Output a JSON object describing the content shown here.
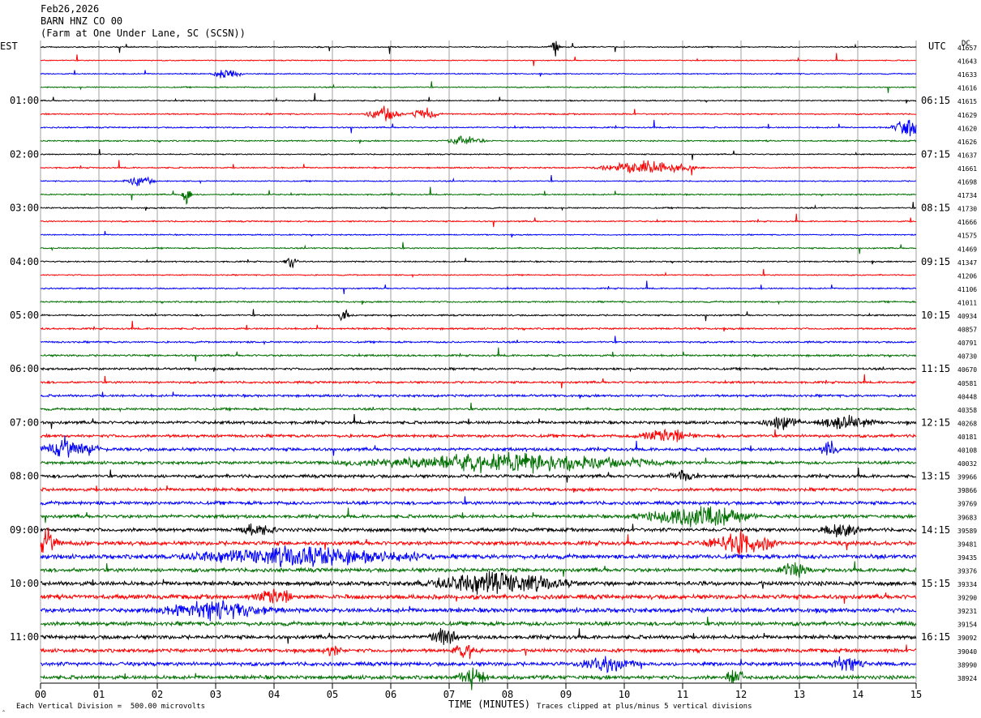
{
  "header": {
    "date": "Feb26,2026",
    "station": "BARN HNZ CO 00",
    "location": "(Farm at One Under Lane, SC (SCSN))"
  },
  "labels": {
    "left_tz": "EST",
    "right_tz": "UTC",
    "dc": "DC",
    "xlabel": "TIME (MINUTES)",
    "scale_note": "Each Vertical Division =  500.00 microvolts",
    "clip_note": "Traces clipped at plus/minus 5 vertical divisions",
    "corner_mark": "‸"
  },
  "chart_data": {
    "type": "line",
    "title": "Feb26,2026 BARN HNZ CO 00 (Farm at One Under Lane, SC (SCSN))",
    "xlabel": "TIME (MINUTES)",
    "xlim": [
      0,
      15
    ],
    "x_ticks": [
      "00",
      "01",
      "02",
      "03",
      "04",
      "05",
      "06",
      "07",
      "08",
      "09",
      "10",
      "11",
      "12",
      "13",
      "14",
      "15"
    ],
    "grid": true,
    "rows_per_hour": 4,
    "trace_colors": [
      "#000000",
      "#ff0000",
      "#0000ff",
      "#007000"
    ],
    "left_hour_labels": [
      "01:00",
      "02:00",
      "03:00",
      "04:00",
      "05:00",
      "06:00",
      "07:00",
      "08:00",
      "09:00",
      "10:00",
      "11:00"
    ],
    "right_hour_labels": [
      "06:15",
      "07:15",
      "08:15",
      "09:15",
      "10:15",
      "11:15",
      "12:15",
      "13:15",
      "14:15",
      "15:15",
      "16:15"
    ],
    "dc_values": [
      41657,
      41643,
      41633,
      41616,
      41615,
      41629,
      41620,
      41626,
      41637,
      41661,
      41698,
      41734,
      41730,
      41666,
      41575,
      41469,
      41347,
      41206,
      41106,
      41011,
      40934,
      40857,
      40791,
      40730,
      40670,
      40581,
      40448,
      40358,
      40268,
      40181,
      40108,
      40032,
      39966,
      39866,
      39769,
      39683,
      39589,
      39481,
      39435,
      39376,
      39334,
      39290,
      39231,
      39154,
      39092,
      39040,
      38990,
      38924
    ],
    "row_activity": [
      0.6,
      0.5,
      0.6,
      0.6,
      0.6,
      0.7,
      0.7,
      0.7,
      0.6,
      0.7,
      0.6,
      0.7,
      0.7,
      0.7,
      0.6,
      0.7,
      0.7,
      0.6,
      0.7,
      0.8,
      0.8,
      0.9,
      0.9,
      1.0,
      1.1,
      1.1,
      1.2,
      1.2,
      1.5,
      1.5,
      1.6,
      1.5,
      1.6,
      1.6,
      1.7,
      1.7,
      1.8,
      2.0,
      2.2,
      1.9,
      2.1,
      2.2,
      2.2,
      2.0,
      1.9,
      1.8,
      1.9,
      1.9
    ],
    "events": [
      {
        "row": 0,
        "minute": 8.8,
        "amp": 3.0,
        "dur": 0.1
      },
      {
        "row": 2,
        "minute": 3.2,
        "amp": 1.5,
        "dur": 0.3
      },
      {
        "row": 5,
        "minute": 5.9,
        "amp": 2.0,
        "dur": 0.4
      },
      {
        "row": 5,
        "minute": 6.6,
        "amp": 1.6,
        "dur": 0.3
      },
      {
        "row": 6,
        "minute": 14.9,
        "amp": 2.5,
        "dur": 0.4
      },
      {
        "row": 7,
        "minute": 7.3,
        "amp": 1.5,
        "dur": 0.4
      },
      {
        "row": 9,
        "minute": 10.4,
        "amp": 1.8,
        "dur": 1.0
      },
      {
        "row": 10,
        "minute": 1.7,
        "amp": 1.5,
        "dur": 0.3
      },
      {
        "row": 11,
        "minute": 2.5,
        "amp": 2.5,
        "dur": 0.1
      },
      {
        "row": 16,
        "minute": 4.3,
        "amp": 2.0,
        "dur": 0.15
      },
      {
        "row": 20,
        "minute": 5.2,
        "amp": 2.5,
        "dur": 0.1
      },
      {
        "row": 28,
        "minute": 12.7,
        "amp": 2.0,
        "dur": 0.4
      },
      {
        "row": 28,
        "minute": 13.8,
        "amp": 2.0,
        "dur": 0.6
      },
      {
        "row": 29,
        "minute": 10.7,
        "amp": 2.0,
        "dur": 0.6
      },
      {
        "row": 30,
        "minute": 0.5,
        "amp": 2.5,
        "dur": 0.6
      },
      {
        "row": 30,
        "minute": 13.5,
        "amp": 2.5,
        "dur": 0.2
      },
      {
        "row": 31,
        "minute": 8.0,
        "amp": 2.5,
        "dur": 3.2
      },
      {
        "row": 32,
        "minute": 11.0,
        "amp": 1.5,
        "dur": 0.3
      },
      {
        "row": 35,
        "minute": 11.2,
        "amp": 3.0,
        "dur": 1.2
      },
      {
        "row": 36,
        "minute": 3.7,
        "amp": 2.0,
        "dur": 0.4
      },
      {
        "row": 36,
        "minute": 13.7,
        "amp": 2.0,
        "dur": 0.4
      },
      {
        "row": 37,
        "minute": 0.1,
        "amp": 3.0,
        "dur": 0.3
      },
      {
        "row": 37,
        "minute": 12.0,
        "amp": 3.0,
        "dur": 0.8
      },
      {
        "row": 38,
        "minute": 4.5,
        "amp": 2.5,
        "dur": 2.5
      },
      {
        "row": 39,
        "minute": 12.9,
        "amp": 2.5,
        "dur": 0.3
      },
      {
        "row": 40,
        "minute": 7.8,
        "amp": 3.0,
        "dur": 1.5
      },
      {
        "row": 41,
        "minute": 4.0,
        "amp": 2.5,
        "dur": 0.4
      },
      {
        "row": 42,
        "minute": 3.0,
        "amp": 2.5,
        "dur": 1.2
      },
      {
        "row": 44,
        "minute": 6.9,
        "amp": 2.5,
        "dur": 0.3
      },
      {
        "row": 45,
        "minute": 5.0,
        "amp": 1.8,
        "dur": 0.2
      },
      {
        "row": 45,
        "minute": 7.3,
        "amp": 2.0,
        "dur": 0.3
      },
      {
        "row": 46,
        "minute": 9.7,
        "amp": 2.0,
        "dur": 0.6
      },
      {
        "row": 46,
        "minute": 13.8,
        "amp": 2.0,
        "dur": 0.4
      },
      {
        "row": 47,
        "minute": 7.4,
        "amp": 3.0,
        "dur": 0.3
      },
      {
        "row": 47,
        "minute": 11.9,
        "amp": 2.5,
        "dur": 0.2
      }
    ]
  }
}
